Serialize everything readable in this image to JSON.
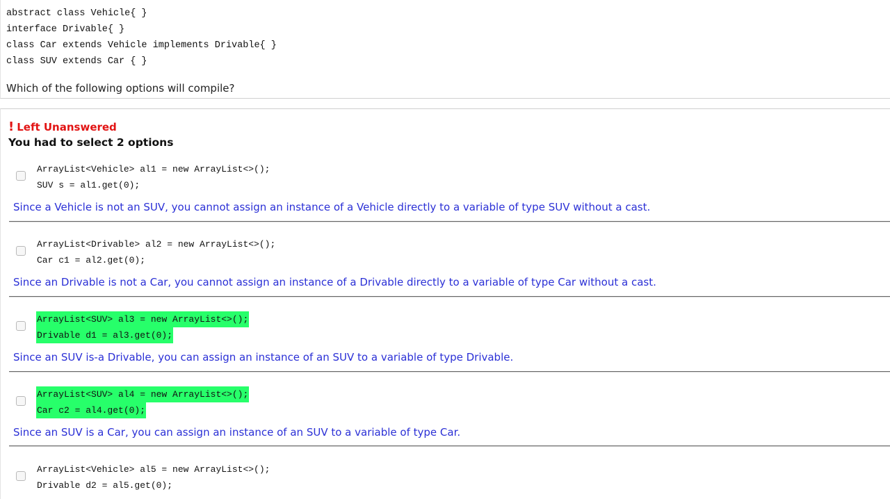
{
  "question": {
    "code": [
      "abstract class Vehicle{ }",
      "interface Drivable{ }",
      "class Car extends Vehicle implements Drivable{ }",
      "class SUV extends Car { }"
    ],
    "prompt": "Which of the following options will compile?"
  },
  "result": {
    "status_mark": "!",
    "status": "Left Unanswered",
    "instruction": "You had to select 2 options"
  },
  "options": [
    {
      "line1": "ArrayList<Vehicle> al1 = new ArrayList<>();",
      "line2": "SUV s = al1.get(0);",
      "correct": false,
      "explanation": "Since a Vehicle is not an SUV, you cannot assign an instance of a Vehicle directly to a variable of type SUV without a cast."
    },
    {
      "line1": "ArrayList<Drivable> al2 = new ArrayList<>();",
      "line2": "Car c1 = al2.get(0);",
      "correct": false,
      "explanation": "Since an Drivable is not a Car, you cannot assign an instance of a Drivable directly to a variable of type Car without a cast."
    },
    {
      "line1": "ArrayList<SUV> al3 = new ArrayList<>();",
      "line2": "Drivable d1 = al3.get(0);",
      "correct": true,
      "explanation": "Since an SUV is-a Drivable, you can assign an instance of an SUV to a variable of type Drivable."
    },
    {
      "line1": "ArrayList<SUV> al4 = new ArrayList<>();",
      "line2": "Car c2 = al4.get(0);",
      "correct": true,
      "explanation": "Since an SUV is a Car, you can assign an instance of an SUV to a variable of type Car."
    },
    {
      "line1": "ArrayList<Vehicle> al5 = new ArrayList<>();",
      "line2": "Drivable d2 = al5.get(0);",
      "correct": false,
      "explanation": ""
    }
  ],
  "colors": {
    "status": "#e21414",
    "explanation": "#2b30d6",
    "correct_highlight": "#27ff6a"
  }
}
